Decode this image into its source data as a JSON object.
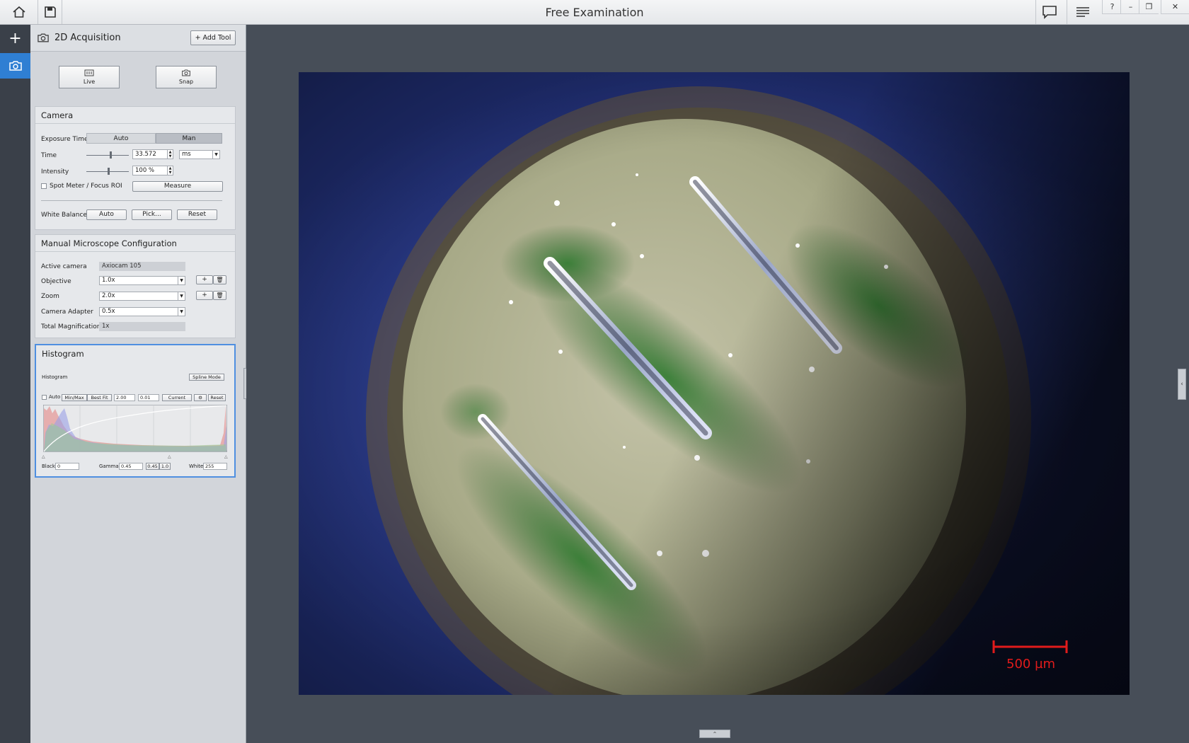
{
  "window": {
    "title": "Free Examination",
    "help_label": "?",
    "minimize_label": "–",
    "restore_label": "❐",
    "close_label": "✕"
  },
  "rail": {
    "add_label": "+"
  },
  "panel": {
    "title": "2D Acquisition",
    "add_tool_label": "+ Add Tool",
    "live_label": "Live",
    "snap_label": "Snap"
  },
  "camera": {
    "title": "Camera",
    "exposure_label": "Exposure Time",
    "auto_label": "Auto",
    "man_label": "Man",
    "time_label": "Time",
    "time_value": "33.572",
    "time_unit": "ms",
    "time_slider": 0.55,
    "intensity_label": "Intensity",
    "intensity_value": "100 %",
    "intensity_slider": 0.5,
    "spot_meter_label": "Spot Meter / Focus ROI",
    "measure_label": "Measure",
    "white_balance_label": "White Balance",
    "wb_auto_label": "Auto",
    "wb_pick_label": "Pick...",
    "wb_reset_label": "Reset"
  },
  "microscope": {
    "title": "Manual Microscope Configuration",
    "active_camera_label": "Active camera",
    "active_camera_value": "Axiocam 105",
    "objective_label": "Objective",
    "objective_value": "1.0x",
    "zoom_label": "Zoom",
    "zoom_value": "2.0x",
    "adapter_label": "Camera Adapter",
    "adapter_value": "0.5x",
    "total_mag_label": "Total Magnification",
    "total_mag_value": "1x",
    "plus_label": "+"
  },
  "histogram": {
    "title": "Histogram",
    "sub_label": "Histogram",
    "spline_label": "Spline Mode",
    "auto_label": "Auto",
    "minmax_label": "Min/Max",
    "bestfit_label": "Best Fit",
    "field1_value": "2.00",
    "field2_value": "0.01",
    "current_label": "Current",
    "reset_label": "Reset",
    "black_label": "Black",
    "black_value": "0",
    "gamma_label": "Gamma",
    "gamma_value": "0.45",
    "gamma_preset1": "0.45",
    "gamma_preset2": "1.0",
    "white_label": "White",
    "white_value": "255"
  },
  "image": {
    "scale_bar_label": "500 µm"
  },
  "colors": {
    "accent": "#2f7fd3",
    "scale_bar": "#e01b1b",
    "viewer_bg": "#474e58"
  }
}
